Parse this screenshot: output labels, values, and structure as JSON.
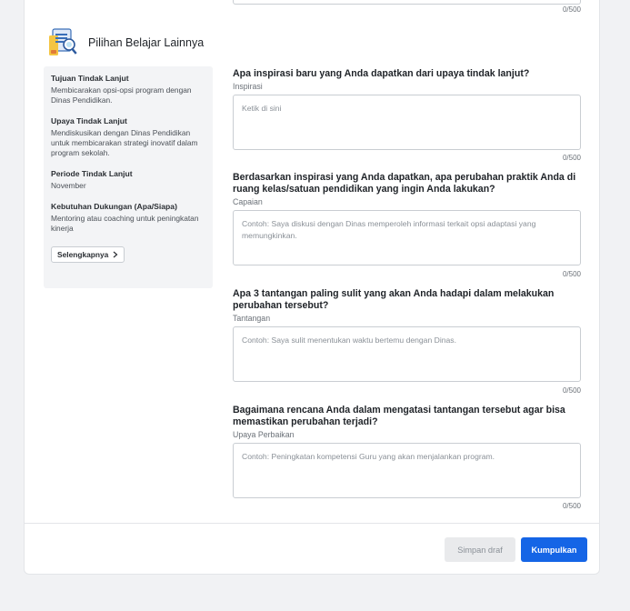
{
  "prev_counter": "0/500",
  "section": {
    "title": "Pilihan Belajar Lainnya"
  },
  "sidebar": {
    "blocks": [
      {
        "label": "Tujuan Tindak Lanjut",
        "value": "Membicarakan opsi-opsi program dengan Dinas Pendidikan."
      },
      {
        "label": "Upaya Tindak Lanjut",
        "value": "Mendiskusikan dengan Dinas Pendidikan untuk membicarakan strategi inovatif dalam program sekolah."
      },
      {
        "label": "Periode Tindak Lanjut",
        "value": "November"
      },
      {
        "label": "Kebutuhan Dukungan (Apa/Siapa)",
        "value": "Mentoring atau coaching untuk peningkatan kinerja"
      }
    ],
    "more_label": "Selengkapnya",
    "more_icon": "chevron-right-icon"
  },
  "questions": [
    {
      "question": "Apa inspirasi baru yang Anda dapatkan dari upaya tindak lanjut?",
      "label": "Inspirasi",
      "placeholder": "Ketik di sini",
      "counter": "0/500"
    },
    {
      "question": "Berdasarkan inspirasi yang Anda dapatkan, apa perubahan praktik Anda di ruang kelas/satuan pendidikan yang ingin Anda lakukan?",
      "label": "Capaian",
      "placeholder": "Contoh: Saya diskusi dengan Dinas memperoleh informasi terkait opsi adaptasi yang memungkinkan.",
      "counter": "0/500"
    },
    {
      "question": "Apa 3 tantangan paling sulit yang akan Anda hadapi dalam melakukan perubahan tersebut?",
      "label": "Tantangan",
      "placeholder": "Contoh: Saya sulit menentukan waktu bertemu dengan Dinas.",
      "counter": "0/500"
    },
    {
      "question": "Bagaimana rencana Anda dalam mengatasi tantangan tersebut agar bisa memastikan perubahan terjadi?",
      "label": "Upaya Perbaikan",
      "placeholder": "Contoh: Peningkatan kompetensi Guru yang akan menjalankan program.",
      "counter": "0/500"
    }
  ],
  "actions": {
    "draft_label": "Simpan draf",
    "submit_label": "Kumpulkan"
  },
  "colors": {
    "primary": "#1565e6",
    "sidebar_bg": "#f3f4f6",
    "page_bg": "#f1f2f4"
  }
}
